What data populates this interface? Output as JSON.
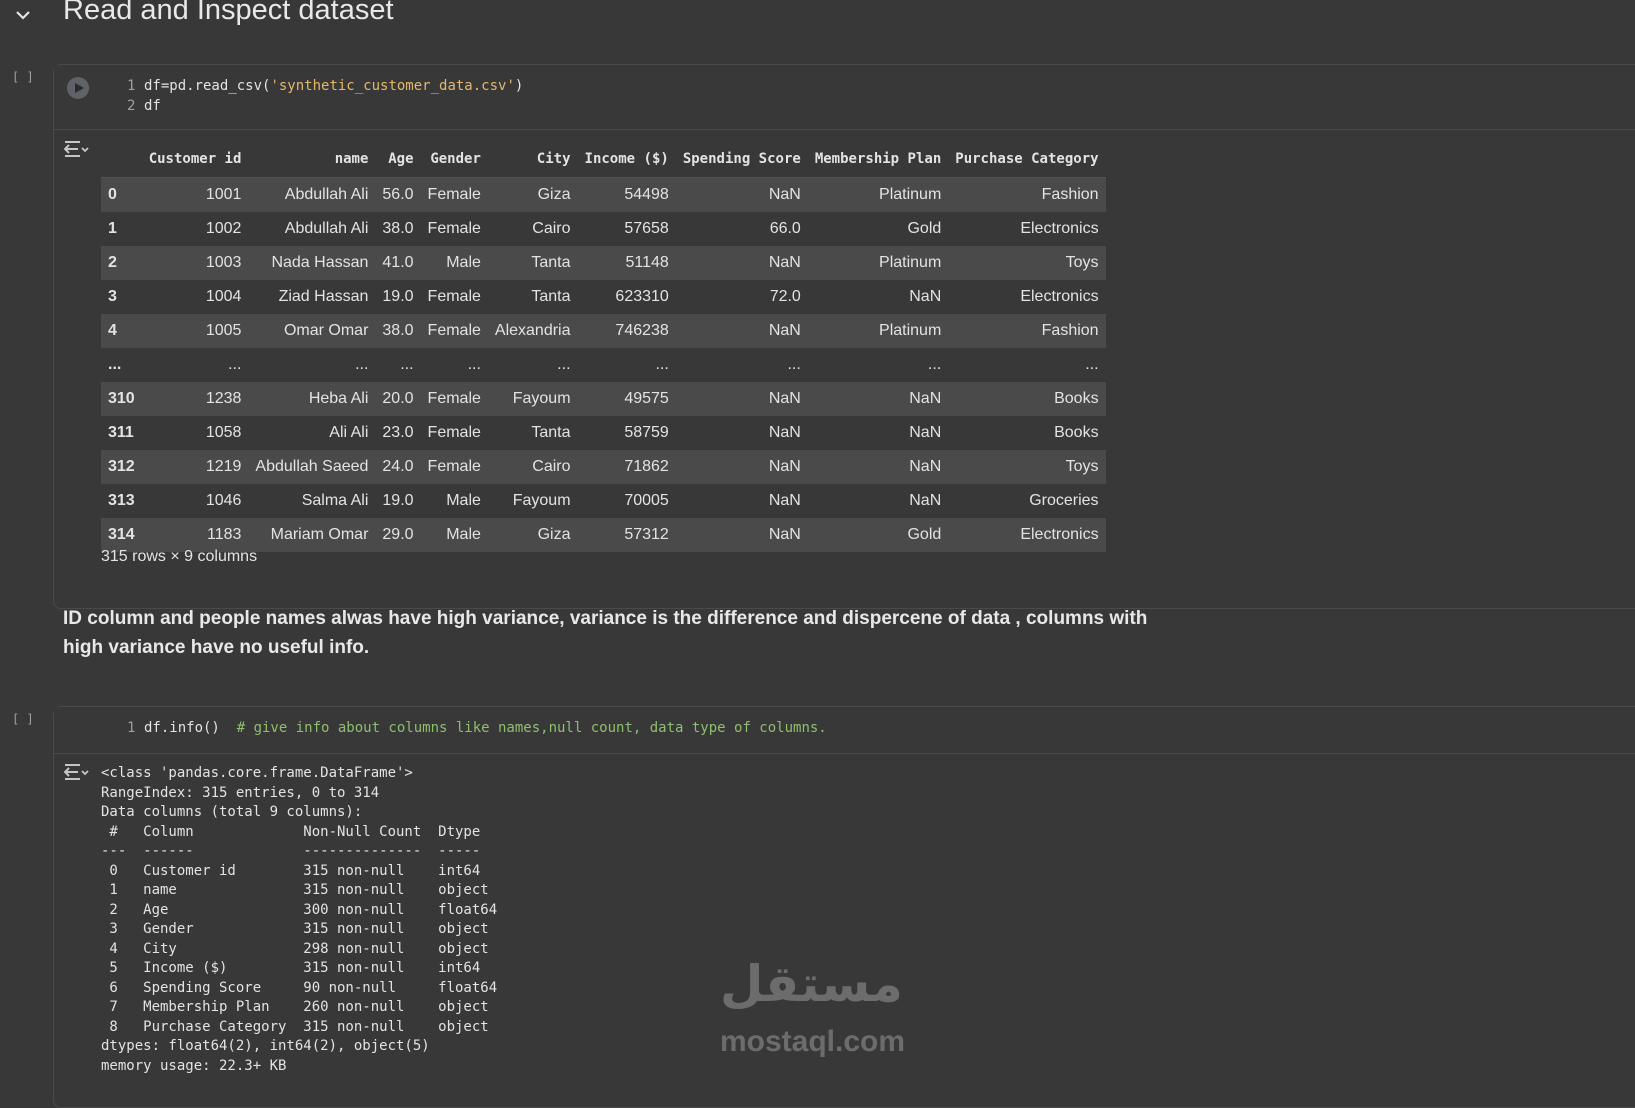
{
  "section": {
    "title": "Read and Inspect dataset"
  },
  "cell1": {
    "exec_count": "[ ]",
    "lines": [
      {
        "num": "1",
        "pre": "df=pd.read_csv(",
        "str": "'synthetic_customer_data.csv'",
        "post": ")"
      },
      {
        "num": "2",
        "code": "df"
      }
    ],
    "table": {
      "columns": [
        "",
        "Customer id",
        "name",
        "Age",
        "Gender",
        "City",
        "Income ($)",
        "Spending Score",
        "Membership Plan",
        "Purchase Category"
      ],
      "rows": [
        [
          "0",
          "1001",
          "Abdullah Ali",
          "56.0",
          "Female",
          "Giza",
          "54498",
          "NaN",
          "Platinum",
          "Fashion"
        ],
        [
          "1",
          "1002",
          "Abdullah Ali",
          "38.0",
          "Female",
          "Cairo",
          "57658",
          "66.0",
          "Gold",
          "Electronics"
        ],
        [
          "2",
          "1003",
          "Nada Hassan",
          "41.0",
          "Male",
          "Tanta",
          "51148",
          "NaN",
          "Platinum",
          "Toys"
        ],
        [
          "3",
          "1004",
          "Ziad Hassan",
          "19.0",
          "Female",
          "Tanta",
          "623310",
          "72.0",
          "NaN",
          "Electronics"
        ],
        [
          "4",
          "1005",
          "Omar Omar",
          "38.0",
          "Female",
          "Alexandria",
          "746238",
          "NaN",
          "Platinum",
          "Fashion"
        ],
        [
          "...",
          "...",
          "...",
          "...",
          "...",
          "...",
          "...",
          "...",
          "...",
          "..."
        ],
        [
          "310",
          "1238",
          "Heba Ali",
          "20.0",
          "Female",
          "Fayoum",
          "49575",
          "NaN",
          "NaN",
          "Books"
        ],
        [
          "311",
          "1058",
          "Ali Ali",
          "23.0",
          "Female",
          "Tanta",
          "58759",
          "NaN",
          "NaN",
          "Books"
        ],
        [
          "312",
          "1219",
          "Abdullah Saeed",
          "24.0",
          "Female",
          "Cairo",
          "71862",
          "NaN",
          "NaN",
          "Toys"
        ],
        [
          "313",
          "1046",
          "Salma Ali",
          "19.0",
          "Male",
          "Fayoum",
          "70005",
          "NaN",
          "NaN",
          "Groceries"
        ],
        [
          "314",
          "1183",
          "Mariam Omar",
          "29.0",
          "Male",
          "Giza",
          "57312",
          "NaN",
          "Gold",
          "Electronics"
        ]
      ],
      "shape": "315 rows × 9 columns"
    }
  },
  "markdown": {
    "text": "ID column and people names alwas have high variance, variance is the difference and dispercene of data , columns with high variance have no useful info."
  },
  "cell2": {
    "exec_count": "[ ]",
    "line": {
      "num": "1",
      "code": "df.info()",
      "comment": "  # give info about columns like names,null count, data type of columns."
    },
    "output": "<class 'pandas.core.frame.DataFrame'>\nRangeIndex: 315 entries, 0 to 314\nData columns (total 9 columns):\n #   Column             Non-Null Count  Dtype  \n---  ------             --------------  -----  \n 0   Customer id        315 non-null    int64  \n 1   name               315 non-null    object \n 2   Age                300 non-null    float64\n 3   Gender             315 non-null    object \n 4   City               298 non-null    object \n 5   Income ($)         315 non-null    int64  \n 6   Spending Score     90 non-null     float64\n 7   Membership Plan    260 non-null    object \n 8   Purchase Category  315 non-null    object \ndtypes: float64(2), int64(2), object(5)\nmemory usage: 22.3+ KB"
  },
  "watermark": {
    "arabic": "مستقل",
    "latin": "mostaql.com"
  }
}
